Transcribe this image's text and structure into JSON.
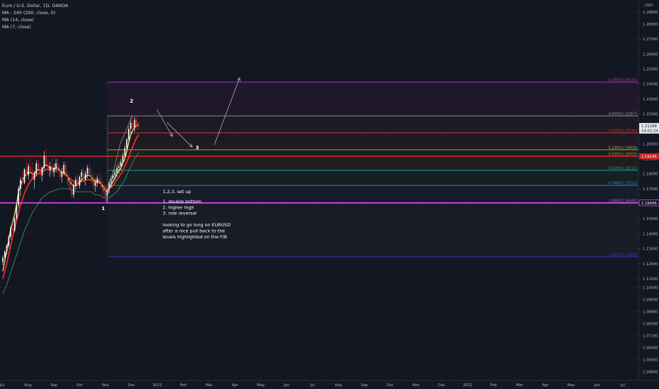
{
  "legend": {
    "symbol": "Euro / U.S. Dollar, 1D, OANDA",
    "indicators": [
      "MA - 240 (200, close, 0)",
      "MA (14, close)",
      "MA (7, close)"
    ]
  },
  "currency_label": "USD",
  "colors": {
    "background": "#131722",
    "up_candle": "#f6f6f6",
    "down_candle": "#c62828",
    "ma14": "#ff2d2d",
    "ma7": "#f5e663",
    "ma200": "#3f9c72",
    "accent_magenta": "#e040fb"
  },
  "chart_data": {
    "type": "candlestick",
    "instrument": "Euro / U.S. Dollar",
    "timeframe": "1D",
    "source": "OANDA",
    "ylim": [
      1.042,
      1.296
    ],
    "y_ticks": [
      "1.28800",
      "1.28000",
      "1.27000",
      "1.26000",
      "1.25000",
      "1.24000",
      "1.23000",
      "1.22000",
      "1.21000",
      "1.20000",
      "1.19000",
      "1.18000",
      "1.17000",
      "1.16000",
      "1.15000",
      "1.14000",
      "1.13000",
      "1.12000",
      "1.11000",
      "1.10400",
      "1.09600",
      "1.08800",
      "1.08000",
      "1.07200",
      "1.06400",
      "1.05600",
      "1.04800"
    ],
    "x_ticks": [
      "Jul",
      "Aug",
      "Sep",
      "Oct",
      "Nov",
      "Dec",
      "2021",
      "Feb",
      "Mar",
      "Apr",
      "May",
      "Jun",
      "Jul",
      "Aug",
      "Sep",
      "Oct",
      "Nov",
      "Dec",
      "2022",
      "Feb",
      "Mar",
      "Apr",
      "May",
      "Jun",
      "Jul"
    ],
    "price_tags": [
      {
        "text": "1.21188",
        "value": 1.2119,
        "style": "light"
      },
      {
        "text": "14:02:24",
        "value": 1.2088,
        "style": "light"
      },
      {
        "text": "1.19145",
        "value": 1.1917,
        "style": "red"
      },
      {
        "text": "1.16045",
        "value": 1.1606,
        "style": "magenta"
      }
    ],
    "fib_levels": [
      {
        "label": "-0.2050(1.24115)",
        "value": 1.2412,
        "color": "#b040b8"
      },
      {
        "label": "0.0000(1.21857)",
        "value": 1.2186,
        "color": "#9598a1"
      },
      {
        "label": "0.1000(1.20730)",
        "value": 1.2073,
        "color": "#c83a3a"
      },
      {
        "label": "0.2360(1.19604)",
        "value": 1.196,
        "color": "#9cb84a"
      },
      {
        "label": "0.5000(1.18503)",
        "value": 1.1917,
        "color": "#e0773a"
      },
      {
        "label": "0.6180(1.18215)",
        "value": 1.1823,
        "color": "#22a89a"
      },
      {
        "label": "0.7860(1.17222)",
        "value": 1.1722,
        "color": "#3b86c4"
      },
      {
        "label": "1.0000(1.16045)",
        "value": 1.1604,
        "color": "#8a8d96"
      },
      {
        "label": "1.6180(1.12459)",
        "value": 1.1246,
        "color": "#3b3bd0"
      }
    ],
    "horizontal_lines": [
      {
        "value": 1.1606,
        "color": "#e040fb"
      },
      {
        "value": 1.1917,
        "color": "#c62828"
      }
    ],
    "annotations": {
      "waves": [
        {
          "text": "1",
          "label": "wave-1-label"
        },
        {
          "text": "2",
          "label": "wave-2-label"
        },
        {
          "text": "3",
          "label": "wave-3-label"
        }
      ],
      "note_title": "1,2,3, set up",
      "note_lines": [
        "1. double bottom",
        "2. higher high",
        "3. role reversal",
        "",
        "looking to go long on EURUSD",
        "after a nice pull back to the",
        "levels highlighted on the FIB"
      ]
    },
    "series": [
      {
        "role": "ohlc",
        "candles": [
          [
            1.121,
            1.1255,
            1.119,
            1.124
          ],
          [
            1.124,
            1.129,
            1.122,
            1.128
          ],
          [
            1.128,
            1.133,
            1.126,
            1.132
          ],
          [
            1.132,
            1.139,
            1.13,
            1.138
          ],
          [
            1.138,
            1.145,
            1.136,
            1.144
          ],
          [
            1.144,
            1.148,
            1.14,
            1.142
          ],
          [
            1.142,
            1.151,
            1.141,
            1.15
          ],
          [
            1.15,
            1.16,
            1.149,
            1.159
          ],
          [
            1.159,
            1.172,
            1.157,
            1.17
          ],
          [
            1.17,
            1.178,
            1.165,
            1.176
          ],
          [
            1.176,
            1.181,
            1.172,
            1.174
          ],
          [
            1.174,
            1.184,
            1.173,
            1.183
          ],
          [
            1.183,
            1.19,
            1.177,
            1.179
          ],
          [
            1.179,
            1.187,
            1.176,
            1.185
          ],
          [
            1.185,
            1.191,
            1.18,
            1.182
          ],
          [
            1.182,
            1.188,
            1.175,
            1.176
          ],
          [
            1.176,
            1.182,
            1.17,
            1.18
          ],
          [
            1.18,
            1.189,
            1.178,
            1.187
          ],
          [
            1.187,
            1.19,
            1.18,
            1.183
          ],
          [
            1.183,
            1.187,
            1.177,
            1.179
          ],
          [
            1.179,
            1.185,
            1.175,
            1.184
          ],
          [
            1.184,
            1.195,
            1.182,
            1.192
          ],
          [
            1.192,
            1.197,
            1.184,
            1.186
          ],
          [
            1.186,
            1.19,
            1.18,
            1.182
          ],
          [
            1.182,
            1.188,
            1.178,
            1.185
          ],
          [
            1.185,
            1.19,
            1.179,
            1.181
          ],
          [
            1.181,
            1.187,
            1.178,
            1.184
          ],
          [
            1.184,
            1.19,
            1.181,
            1.187
          ],
          [
            1.187,
            1.19,
            1.18,
            1.182
          ],
          [
            1.182,
            1.186,
            1.176,
            1.178
          ],
          [
            1.178,
            1.184,
            1.174,
            1.181
          ],
          [
            1.181,
            1.188,
            1.179,
            1.186
          ],
          [
            1.186,
            1.188,
            1.178,
            1.179
          ],
          [
            1.179,
            1.182,
            1.172,
            1.174
          ],
          [
            1.174,
            1.18,
            1.169,
            1.17
          ],
          [
            1.17,
            1.176,
            1.164,
            1.166
          ],
          [
            1.166,
            1.174,
            1.164,
            1.172
          ],
          [
            1.172,
            1.178,
            1.169,
            1.176
          ],
          [
            1.176,
            1.18,
            1.17,
            1.172
          ],
          [
            1.172,
            1.179,
            1.17,
            1.178
          ],
          [
            1.178,
            1.183,
            1.175,
            1.181
          ],
          [
            1.181,
            1.185,
            1.174,
            1.176
          ],
          [
            1.176,
            1.182,
            1.172,
            1.18
          ],
          [
            1.18,
            1.186,
            1.177,
            1.184
          ],
          [
            1.184,
            1.187,
            1.178,
            1.179
          ],
          [
            1.179,
            1.183,
            1.174,
            1.176
          ],
          [
            1.176,
            1.18,
            1.17,
            1.172
          ],
          [
            1.172,
            1.177,
            1.168,
            1.174
          ],
          [
            1.174,
            1.179,
            1.171,
            1.177
          ],
          [
            1.177,
            1.181,
            1.173,
            1.175
          ],
          [
            1.175,
            1.179,
            1.17,
            1.171
          ],
          [
            1.171,
            1.175,
            1.165,
            1.168
          ],
          [
            1.168,
            1.173,
            1.162,
            1.165
          ],
          [
            1.165,
            1.17,
            1.161,
            1.169
          ],
          [
            1.169,
            1.176,
            1.167,
            1.174
          ],
          [
            1.174,
            1.179,
            1.171,
            1.177
          ],
          [
            1.177,
            1.182,
            1.174,
            1.179
          ],
          [
            1.179,
            1.183,
            1.176,
            1.181
          ],
          [
            1.181,
            1.186,
            1.178,
            1.184
          ],
          [
            1.184,
            1.188,
            1.18,
            1.185
          ],
          [
            1.185,
            1.19,
            1.182,
            1.188
          ],
          [
            1.188,
            1.194,
            1.186,
            1.192
          ],
          [
            1.192,
            1.199,
            1.19,
            1.197
          ],
          [
            1.197,
            1.204,
            1.195,
            1.203
          ],
          [
            1.203,
            1.212,
            1.201,
            1.21
          ],
          [
            1.21,
            1.217,
            1.206,
            1.214
          ],
          [
            1.214,
            1.219,
            1.209,
            1.211
          ],
          [
            1.211,
            1.218,
            1.208,
            1.216
          ],
          [
            1.216,
            1.218,
            1.21,
            1.212
          ],
          [
            1.212,
            1.215,
            1.209,
            1.2119
          ]
        ]
      }
    ],
    "ma7": [
      1.115,
      1.122,
      1.129,
      1.136,
      1.143,
      1.148,
      1.153,
      1.16,
      1.168,
      1.172,
      1.176,
      1.178,
      1.18,
      1.181,
      1.181,
      1.18,
      1.18,
      1.182,
      1.183,
      1.182,
      1.183,
      1.185,
      1.186,
      1.185,
      1.184,
      1.184,
      1.183,
      1.184,
      1.184,
      1.182,
      1.181,
      1.181,
      1.18,
      1.178,
      1.175,
      1.173,
      1.172,
      1.172,
      1.173,
      1.174,
      1.176,
      1.177,
      1.178,
      1.179,
      1.179,
      1.178,
      1.176,
      1.175,
      1.175,
      1.175,
      1.173,
      1.171,
      1.169,
      1.168,
      1.17,
      1.172,
      1.175,
      1.177,
      1.18,
      1.182,
      1.184,
      1.187,
      1.19,
      1.195,
      1.201,
      1.206,
      1.209,
      1.211,
      1.212,
      1.213
    ],
    "ma14": [
      1.11,
      1.115,
      1.12,
      1.126,
      1.132,
      1.138,
      1.143,
      1.149,
      1.154,
      1.159,
      1.163,
      1.167,
      1.17,
      1.173,
      1.175,
      1.177,
      1.178,
      1.179,
      1.18,
      1.181,
      1.181,
      1.182,
      1.183,
      1.183,
      1.183,
      1.183,
      1.183,
      1.183,
      1.183,
      1.182,
      1.181,
      1.18,
      1.179,
      1.178,
      1.177,
      1.176,
      1.175,
      1.174,
      1.174,
      1.174,
      1.175,
      1.175,
      1.176,
      1.176,
      1.176,
      1.176,
      1.175,
      1.174,
      1.174,
      1.174,
      1.173,
      1.172,
      1.171,
      1.17,
      1.17,
      1.171,
      1.172,
      1.174,
      1.176,
      1.178,
      1.18,
      1.182,
      1.185,
      1.188,
      1.191,
      1.195,
      1.198,
      1.201,
      1.204,
      1.206
    ],
    "ma200": [
      1.1,
      1.103,
      1.106,
      1.11,
      1.114,
      1.118,
      1.122,
      1.126,
      1.13,
      1.134,
      1.138,
      1.142,
      1.145,
      1.148,
      1.151,
      1.154,
      1.156,
      1.158,
      1.16,
      1.162,
      1.164,
      1.165,
      1.166,
      1.167,
      1.168,
      1.168,
      1.169,
      1.169,
      1.17,
      1.17,
      1.17,
      1.17,
      1.17,
      1.17,
      1.17,
      1.169,
      1.169,
      1.168,
      1.168,
      1.168,
      1.168,
      1.168,
      1.168,
      1.168,
      1.168,
      1.168,
      1.167,
      1.166,
      1.166,
      1.166,
      1.165,
      1.164,
      1.164,
      1.164,
      1.164,
      1.165,
      1.166,
      1.167,
      1.168,
      1.17,
      1.172,
      1.174,
      1.176,
      1.179,
      1.182,
      1.185,
      1.188,
      1.19,
      1.192,
      1.194
    ]
  }
}
